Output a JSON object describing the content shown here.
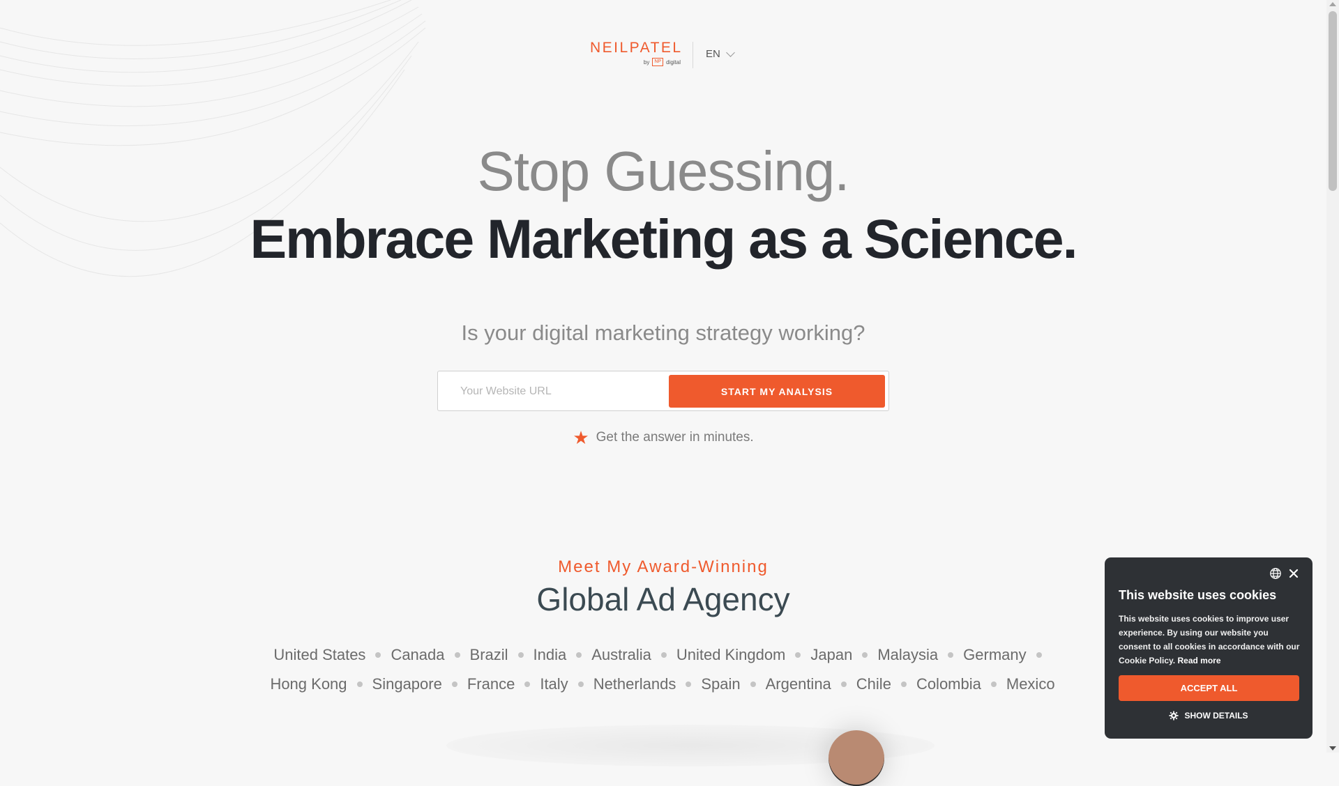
{
  "colors": {
    "accent": "#ef5a2d",
    "cookie_bg": "#2e3135",
    "headline_dark": "#22252b"
  },
  "header": {
    "logo_text": "NEILPATEL",
    "logo_by": "by",
    "logo_np": "NP",
    "logo_digital": "digital",
    "language": "EN"
  },
  "hero": {
    "headline_1": "Stop Guessing.",
    "headline_2": "Embrace Marketing as a Science.",
    "question": "Is your digital marketing strategy working?",
    "url_placeholder": "Your Website URL",
    "cta_label": "START MY ANALYSIS",
    "note": "Get the answer in minutes."
  },
  "agency": {
    "eyebrow": "Meet My Award-Winning",
    "title": "Global Ad Agency",
    "countries": [
      "United States",
      "Canada",
      "Brazil",
      "India",
      "Australia",
      "United Kingdom",
      "Japan",
      "Malaysia",
      "Germany",
      "Hong Kong",
      "Singapore",
      "France",
      "Italy",
      "Netherlands",
      "Spain",
      "Argentina",
      "Chile",
      "Colombia",
      "Mexico"
    ]
  },
  "cookie": {
    "title": "This website uses cookies",
    "text": "This website uses cookies to improve user experience. By using our website you consent to all cookies in accordance with our Cookie Policy.",
    "read_more": "Read more",
    "accept_label": "ACCEPT ALL",
    "details_label": "SHOW DETAILS"
  },
  "icons": [
    "globe-icon",
    "close-icon",
    "gear-icon",
    "star-icon",
    "chevron-down-icon"
  ]
}
